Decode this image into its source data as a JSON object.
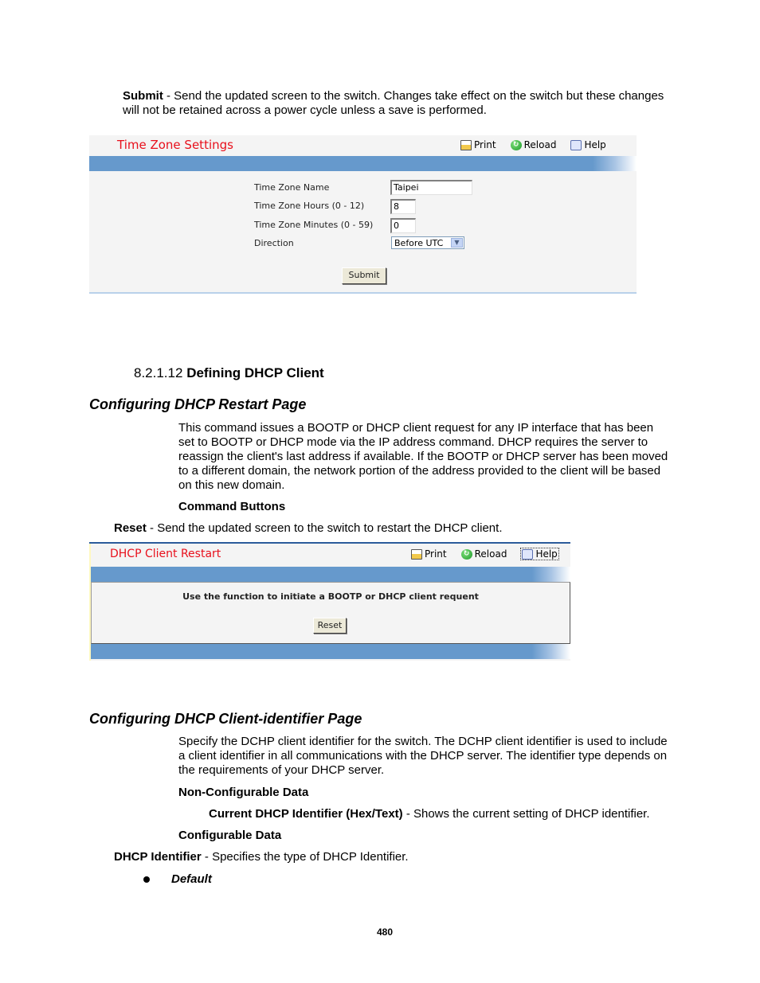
{
  "intro": {
    "submit_term": "Submit",
    "submit_desc": " - Send the updated screen to the switch. Changes take effect on the switch but these changes",
    "submit_desc_2": "will not be retained across a power cycle unless a save is performed."
  },
  "time_zone_panel": {
    "title": "Time Zone Settings",
    "toolbar": {
      "print": "Print",
      "reload": "Reload",
      "help": "Help"
    },
    "fields": [
      {
        "label": "Time Zone Name",
        "value": "Taipei"
      },
      {
        "label": "Time Zone Hours (0 - 12)",
        "value": "8"
      },
      {
        "label": "Time Zone Minutes (0 - 59)",
        "value": "0"
      },
      {
        "label": "Direction",
        "value": "Before UTC"
      }
    ],
    "submit_button": "Submit",
    "colors": {
      "title": "#e8101c",
      "bar": "#6699cc",
      "panel_bg": "#f4f4f4"
    }
  },
  "section": {
    "number": "8.2.1.12",
    "title": "Defining DHCP Client"
  },
  "restart_section": {
    "heading": "Configuring DHCP Restart Page",
    "paragraph_lines": [
      "This command issues a BOOTP or DHCP client request for any IP interface that has been",
      "set to BOOTP or DHCP mode via the IP address command. DHCP requires the server to",
      "reassign the client's last address if available. If the BOOTP or DHCP server has been moved",
      "to a different domain, the network portion of the address provided to the client will be based",
      "on this new domain."
    ],
    "command_buttons_label": "Command Buttons",
    "reset_term": "Reset",
    "reset_desc": " - Send the updated screen to the switch to restart the DHCP client."
  },
  "restart_panel": {
    "title": "DHCP Client Restart",
    "toolbar": {
      "print": "Print",
      "reload": "Reload",
      "help": "Help"
    },
    "message": "Use the function to initiate a BOOTP or DHCP client requent",
    "reset_button": "Reset"
  },
  "identifier_section": {
    "heading": "Configuring DHCP Client-identifier Page",
    "paragraph_lines": [
      "Specify the DCHP client identifier for the switch. The DCHP client identifier is used to include",
      "a client identifier in all communications with the DHCP server. The identifier type depends on",
      "the requirements of your DHCP server."
    ],
    "non_configurable_label": "Non-Configurable Data",
    "current_id_term": "Current DHCP Identifier (Hex/Text)",
    "current_id_desc": " - Shows the current setting of DHCP identifier.",
    "configurable_label": "Configurable Data",
    "dhcp_id_term": "DHCP Identifier",
    "dhcp_id_desc": " - Specifies the type of DHCP Identifier.",
    "bullets": [
      "Default"
    ]
  },
  "footer": {
    "page_number": "480"
  }
}
